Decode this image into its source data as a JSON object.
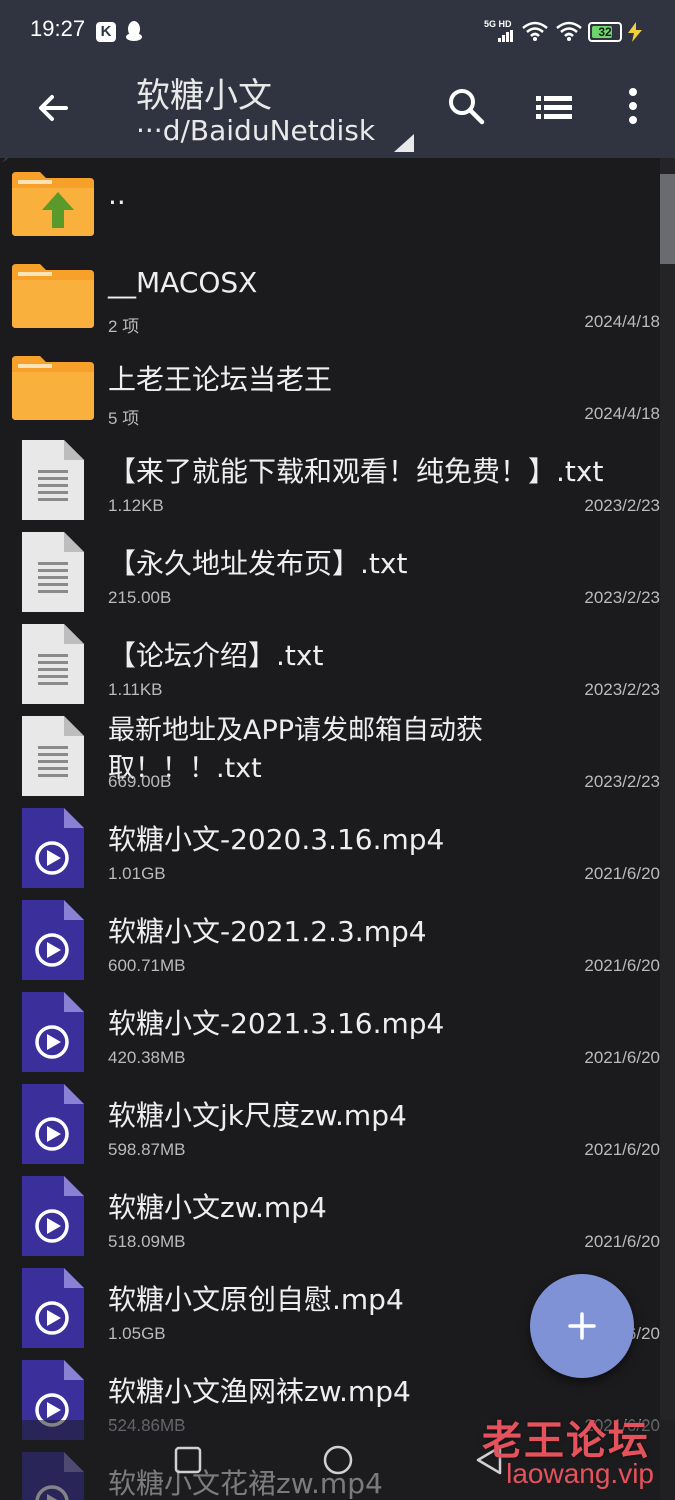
{
  "status_bar": {
    "time": "19:27",
    "k_badge": "K",
    "network_label": "5G HD",
    "battery_level": "32"
  },
  "app_bar": {
    "title": "软糖小文",
    "path": "···d/BaiduNetdisk"
  },
  "files": [
    {
      "type": "parent-folder",
      "name": "..",
      "meta": "",
      "date": ""
    },
    {
      "type": "folder",
      "name": "__MACOSX",
      "meta": "2 项",
      "date": "2024/4/18"
    },
    {
      "type": "folder",
      "name": "上老王论坛当老王",
      "meta": "5 项",
      "date": "2024/4/18"
    },
    {
      "type": "text",
      "name": "【来了就能下载和观看！纯免费！】.txt",
      "meta": "1.12KB",
      "date": "2023/2/23"
    },
    {
      "type": "text",
      "name": "【永久地址发布页】.txt",
      "meta": "215.00B",
      "date": "2023/2/23"
    },
    {
      "type": "text",
      "name": "【论坛介绍】.txt",
      "meta": "1.11KB",
      "date": "2023/2/23"
    },
    {
      "type": "text",
      "name": "最新地址及APP请发邮箱自动获取！！！.txt",
      "meta": "669.00B",
      "date": "2023/2/23"
    },
    {
      "type": "video",
      "name": "软糖小文-2020.3.16.mp4",
      "meta": "1.01GB",
      "date": "2021/6/20"
    },
    {
      "type": "video",
      "name": "软糖小文-2021.2.3.mp4",
      "meta": "600.71MB",
      "date": "2021/6/20"
    },
    {
      "type": "video",
      "name": "软糖小文-2021.3.16.mp4",
      "meta": "420.38MB",
      "date": "2021/6/20"
    },
    {
      "type": "video",
      "name": "软糖小文jk尺度zw.mp4",
      "meta": "598.87MB",
      "date": "2021/6/20"
    },
    {
      "type": "video",
      "name": "软糖小文zw.mp4",
      "meta": "518.09MB",
      "date": "2021/6/20"
    },
    {
      "type": "video",
      "name": "软糖小文原创自慰.mp4",
      "meta": "1.05GB",
      "date": "2021/6/20"
    },
    {
      "type": "video",
      "name": "软糖小文渔网袜zw.mp4",
      "meta": "524.86MB",
      "date": "2021/6/20"
    },
    {
      "type": "video",
      "name": "软糖小文花裙zw.mp4",
      "meta": "",
      "date": ""
    }
  ],
  "watermark": {
    "line1": "老王论坛",
    "line2": "laowang.vip"
  },
  "colors": {
    "app_bar": "#2f3440",
    "folder": "#f7a12a",
    "video_icon": "#3b2f9b",
    "fab": "#7f92d6",
    "watermark": "#e6525c"
  }
}
